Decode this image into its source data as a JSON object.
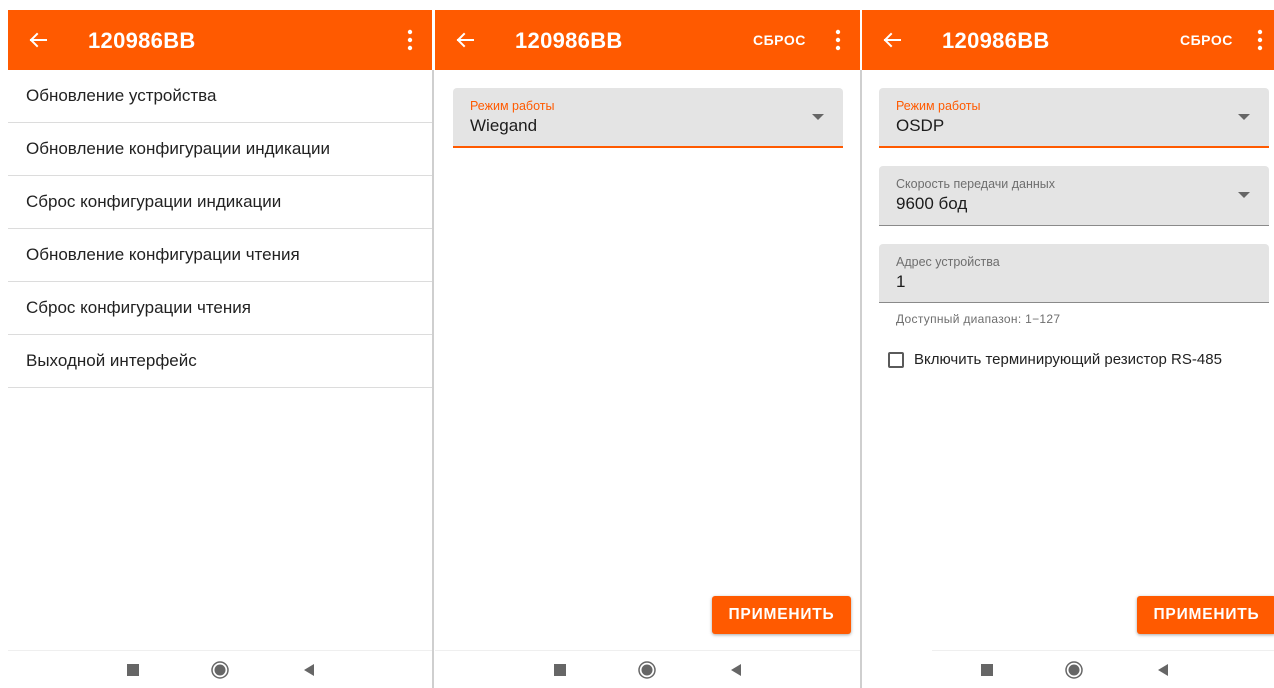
{
  "device_title": "120986BB",
  "colors": {
    "accent": "#ff5a00",
    "field_bg": "#e4e4e4"
  },
  "screen1": {
    "menu_items": [
      "Обновление устройства",
      "Обновление конфигурации индикации",
      "Сброс конфигурации индикации",
      "Обновление конфигурации чтения",
      "Сброс конфигурации чтения",
      "Выходной интерфейс"
    ]
  },
  "screen2": {
    "reset_label": "СБРОС",
    "mode_field": {
      "label": "Режим работы",
      "value": "Wiegand"
    },
    "apply_label": "ПРИМЕНИТЬ"
  },
  "screen3": {
    "reset_label": "СБРОС",
    "mode_field": {
      "label": "Режим работы",
      "value": "OSDP"
    },
    "baud_field": {
      "label": "Скорость передачи данных",
      "value": "9600 бод"
    },
    "address_field": {
      "label": "Адрес устройства",
      "value": "1"
    },
    "address_helper": "Доступный диапазон: 1−127",
    "terminator_checkbox": {
      "label": "Включить терминирующий резистор RS-485",
      "checked": false
    },
    "apply_label": "ПРИМЕНИТЬ"
  },
  "icons": {
    "back": "arrow-left-icon",
    "more": "more-vert-icon",
    "dropdown": "arrow-drop-down-icon",
    "nav_recents": "square-stop-icon",
    "nav_home": "circle-home-icon",
    "nav_back": "triangle-back-icon"
  }
}
